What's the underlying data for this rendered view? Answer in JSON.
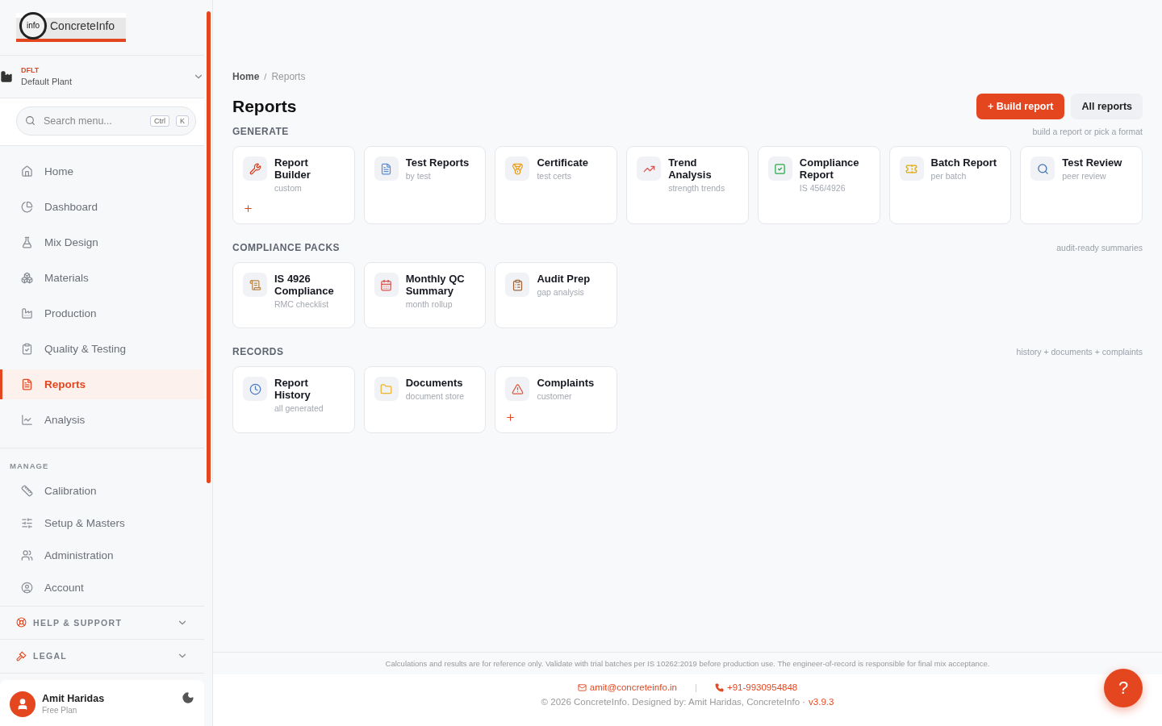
{
  "logo": {
    "mark": "info",
    "name": "ConcreteInfo"
  },
  "plant": {
    "code": "DFLT",
    "name": "Default Plant"
  },
  "search": {
    "placeholder": "Search menu...",
    "keys": [
      "Ctrl",
      "K"
    ]
  },
  "nav": [
    {
      "label": "Home",
      "selected": false
    },
    {
      "label": "Dashboard",
      "selected": false
    },
    {
      "label": "Mix Design",
      "selected": false
    },
    {
      "label": "Materials",
      "selected": false
    },
    {
      "label": "Production",
      "selected": false
    },
    {
      "label": "Quality & Testing",
      "selected": false
    },
    {
      "label": "Reports",
      "selected": true
    },
    {
      "label": "Analysis",
      "selected": false
    }
  ],
  "manage": {
    "title": "MANAGE",
    "items": [
      {
        "label": "Calibration"
      },
      {
        "label": "Setup & Masters"
      },
      {
        "label": "Administration"
      },
      {
        "label": "Account"
      }
    ]
  },
  "collapsibles": [
    {
      "label": "HELP & SUPPORT",
      "expanded": false
    },
    {
      "label": "LEGAL",
      "expanded": false
    }
  ],
  "user": {
    "name": "Amit Haridas",
    "plan": "Free Plan"
  },
  "breadcrumb": [
    "Home",
    "Reports"
  ],
  "breadcrumb_separator": "/",
  "title": "Reports",
  "actions": {
    "primary": "+ Build report",
    "secondary": "All reports"
  },
  "sections": [
    {
      "title": "GENERATE",
      "hint": "build a report or pick a format",
      "cards": [
        {
          "title": "Report Builder",
          "subtitle": "custom",
          "addable": true
        },
        {
          "title": "Test Reports",
          "subtitle": "by test",
          "addable": false
        },
        {
          "title": "Certificate",
          "subtitle": "test certs",
          "addable": false
        },
        {
          "title": "Trend Analysis",
          "subtitle": "strength trends",
          "addable": false
        },
        {
          "title": "Compliance Report",
          "subtitle": "IS 456/4926",
          "addable": false
        },
        {
          "title": "Batch Report",
          "subtitle": "per batch",
          "addable": false
        },
        {
          "title": "Test Review",
          "subtitle": "peer review",
          "addable": false
        }
      ]
    },
    {
      "title": "COMPLIANCE PACKS",
      "hint": "audit-ready summaries",
      "cards": [
        {
          "title": "IS 4926 Compliance",
          "subtitle": "RMC checklist",
          "addable": false
        },
        {
          "title": "Monthly QC Summary",
          "subtitle": "month rollup",
          "addable": false
        },
        {
          "title": "Audit Prep",
          "subtitle": "gap analysis",
          "addable": false
        }
      ]
    },
    {
      "title": "RECORDS",
      "hint": "history + documents + complaints",
      "cards": [
        {
          "title": "Report History",
          "subtitle": "all generated",
          "addable": false
        },
        {
          "title": "Documents",
          "subtitle": "document store",
          "addable": false
        },
        {
          "title": "Complaints",
          "subtitle": "customer",
          "addable": true
        }
      ]
    }
  ],
  "footer": {
    "disclaimer": "Calculations and results are for reference only. Validate with trial batches per IS 10262:2019 before production use. The engineer-of-record is responsible for final mix acceptance.",
    "email": "amit@concreteinfo.in",
    "separator": "|",
    "phone": "+91-9930954848",
    "copyright": "© 2026 ConcreteInfo. Designed by: Amit Haridas, ConcreteInfo ·",
    "version": "v3.9.3"
  },
  "help": "?"
}
